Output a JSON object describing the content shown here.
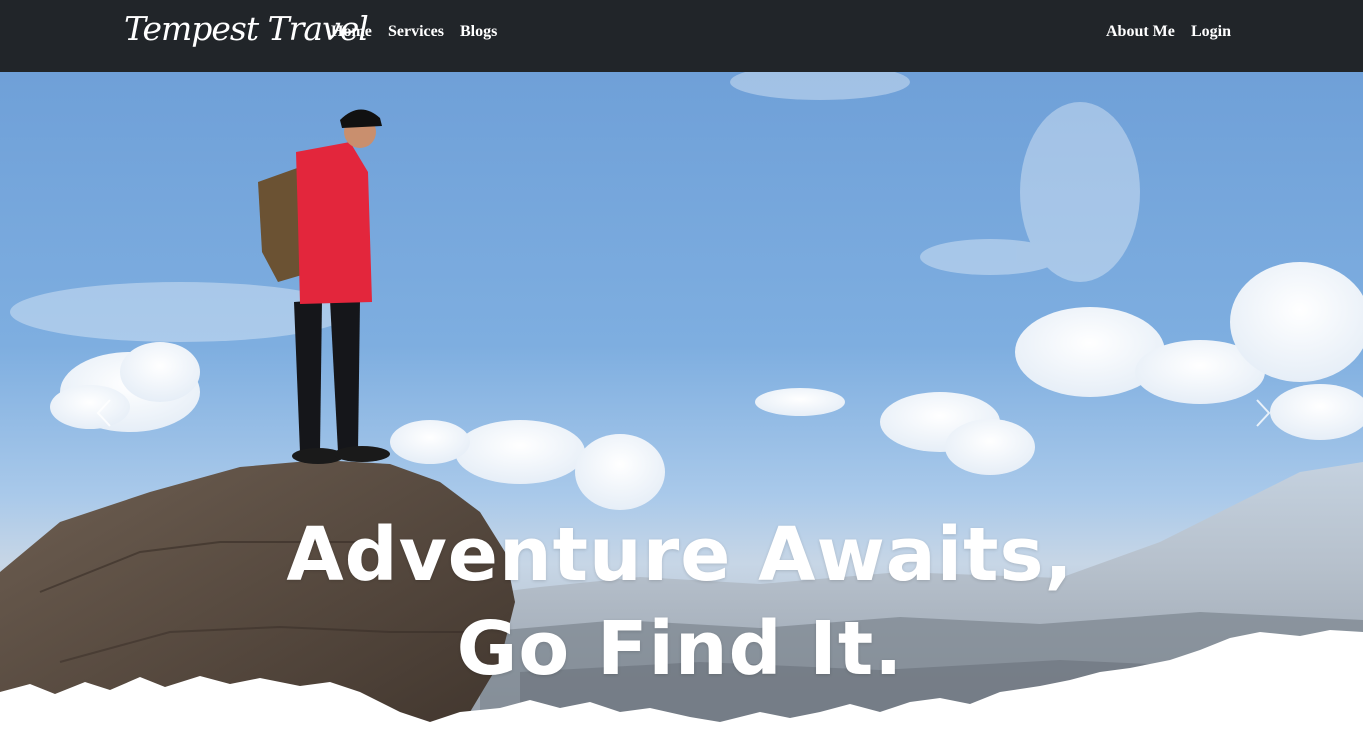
{
  "nav": {
    "brand": "Tempest Travel",
    "links": {
      "home": "Home",
      "services": "Services",
      "blogs": "Blogs",
      "about": "About Me",
      "login": "Login"
    }
  },
  "hero": {
    "headline": "Adventure Awaits, Go Find It.",
    "prev_icon": "chevron-left-icon",
    "next_icon": "chevron-right-icon"
  },
  "colors": {
    "navbar": "#212529",
    "nav_text": "#ffffff",
    "sky": "#7eaee0",
    "headline": "#ffffff"
  }
}
